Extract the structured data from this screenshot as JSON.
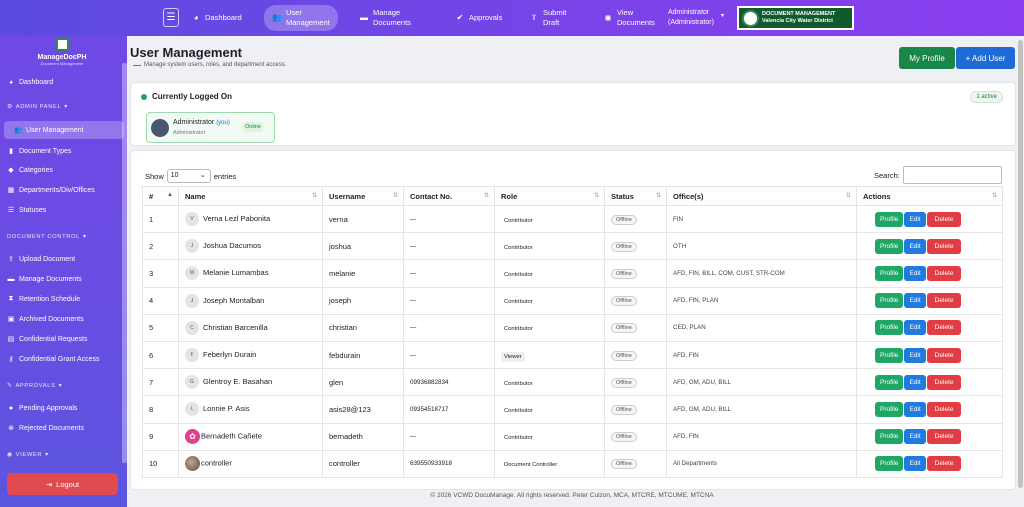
{
  "topbar": {
    "nav": [
      {
        "label": "Dashboard",
        "icon": "dashboard-icon",
        "glyph": "◕"
      },
      {
        "label": "User\nManagement",
        "icon": "users-icon",
        "glyph": "👥"
      },
      {
        "label": "Manage\nDocuments",
        "icon": "folder-icon",
        "glyph": "▬"
      },
      {
        "label": "Approvals",
        "icon": "check-circle-icon",
        "glyph": "✔"
      },
      {
        "label": "Submit\nDraft",
        "icon": "upload-icon",
        "glyph": "⇪"
      },
      {
        "label": "View\nDocuments",
        "icon": "eye-icon",
        "glyph": "◉"
      }
    ],
    "admin_name": "Administrator",
    "admin_role": "(Administrator)",
    "brand_line1": "DOCUMENT MANAGEMENT",
    "brand_line2": "Valencia City Water District"
  },
  "sidebar": {
    "app_name": "ManageDocPH",
    "app_tagline": "Document Management",
    "dashboard": "Dashboard",
    "admin_panel": "ADMIN PANEL",
    "admin_items": [
      "User Management",
      "Document Types",
      "Categories",
      "Departments/Div/Offices",
      "Statuses"
    ],
    "doc_control": "DOCUMENT CONTROL",
    "doc_items": [
      "Upload Document",
      "Manage Documents",
      "Retention Schedule",
      "Archived Documents",
      "Confidential Requests",
      "Confidential Grant Access"
    ],
    "approvals": "APPROVALS",
    "approval_items": [
      "Pending Approvals",
      "Rejected Documents"
    ],
    "viewer": "VIEWER",
    "logout": "Logout"
  },
  "header": {
    "title": "User Management",
    "subtitle": "Manage system users, roles, and department access.",
    "my_profile": "My Profile",
    "add_user": "+ Add User"
  },
  "logged_on": {
    "title": "Currently Logged On",
    "badge": "1 active",
    "user_name": "Administrator",
    "user_you": "(you)",
    "user_role": "Administrator",
    "user_status": "Online"
  },
  "table": {
    "show_label": "Show",
    "show_value": "10",
    "entries_label": "entries",
    "search_label": "Search:",
    "columns": [
      "#",
      "Name",
      "Username",
      "Contact No.",
      "Role",
      "Status",
      "Office(s)",
      "Actions"
    ],
    "actions": {
      "profile": "Profile",
      "edit": "Edit",
      "delete": "Delete"
    },
    "rows": [
      {
        "no": "1",
        "initial": "V",
        "name": "Verna Lezl Pabonita",
        "username": "verna",
        "contact": "—",
        "role": "Contributor",
        "status": "Offline",
        "offices": "FIN"
      },
      {
        "no": "2",
        "initial": "J",
        "name": "Joshua Dacumos",
        "username": "joshua",
        "contact": "—",
        "role": "Contributor",
        "status": "Offline",
        "offices": "OTH"
      },
      {
        "no": "3",
        "initial": "M",
        "name": "Melanie Lumambas",
        "username": "melanie",
        "contact": "—",
        "role": "Contributor",
        "status": "Offline",
        "offices": "AFD, FIN, BILL, COM, CUST, STR-COM"
      },
      {
        "no": "4",
        "initial": "J",
        "name": "Joseph Montalban",
        "username": "joseph",
        "contact": "—",
        "role": "Contributor",
        "status": "Offline",
        "offices": "AFD, FIN, PLAN"
      },
      {
        "no": "5",
        "initial": "C",
        "name": "Christian Barcenilla",
        "username": "christian",
        "contact": "—",
        "role": "Contributor",
        "status": "Offline",
        "offices": "CED, PLAN"
      },
      {
        "no": "6",
        "initial": "F",
        "name": "Feberlyn Durain",
        "username": "febdurain",
        "contact": "—",
        "role": "Viewer",
        "status": "Offline",
        "offices": "AFD, FIN"
      },
      {
        "no": "7",
        "initial": "G",
        "name": "Glentroy E. Basahan",
        "username": "glen",
        "contact": "09936882834",
        "role": "Contributor",
        "status": "Offline",
        "offices": "AFD, GM, ADU, BILL"
      },
      {
        "no": "8",
        "initial": "L",
        "name": "Lonnie P. Asis",
        "username": "asis28@123",
        "contact": "09354518717",
        "role": "Contributor",
        "status": "Offline",
        "offices": "AFD, GM, ADU, BILL"
      },
      {
        "no": "9",
        "initial": "B",
        "name": "Bernadeth Cañete",
        "username": "bernadeth",
        "contact": "—",
        "role": "Contributor",
        "status": "Offline",
        "offices": "AFD, FIN"
      },
      {
        "no": "10",
        "initial": "",
        "name": "controller",
        "username": "controller",
        "contact": "639550933918",
        "role": "Document Controller",
        "status": "Offline",
        "offices": "All Departments"
      }
    ]
  },
  "footer": "© 2026 VCWD DocuManage. All rights reserved. Peter Culzon, MCA, MTCRE, MTCUME, MTCNA"
}
